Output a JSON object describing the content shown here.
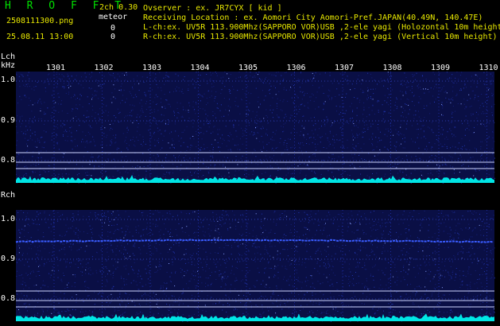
{
  "header": {
    "app_title": "H R O F F T",
    "channel_mode": "2ch 0.30",
    "file_name": "2508111300.png",
    "meteor_label": "meteor",
    "meteor_count_l": "0",
    "timestamp": "25.08.11 13:00",
    "meteor_count_r": "0",
    "observer_line": "Ovserver              : ex. JR7CYX [ kid ]",
    "location_line": "Receiving Location : ex. Aomori City Aomori-Pref.JAPAN(40.49N, 140.47E)",
    "lch_line": "L-ch:ex. UV5R 113.900Mhz(SAPPORO VOR)USB ,2-ele yagi (Holozontal 10m height)",
    "rch_line": "R-ch:ex. UV5R 113.900Mhz(SAPPORO VOR)USB ,2-ele yagi (Vertical 10m height)"
  },
  "time_axis": {
    "ticks": [
      "1301",
      "1302",
      "1303",
      "1304",
      "1305",
      "1306",
      "1307",
      "1308",
      "1309",
      "1310"
    ]
  },
  "lch_panel": {
    "label": "Lch",
    "unit": "kHz",
    "y_ticks": [
      "1.0",
      "0.9",
      "0.8"
    ]
  },
  "rch_panel": {
    "label": "Rch",
    "y_ticks": [
      "1.0",
      "0.9",
      "0.8"
    ]
  },
  "colors": {
    "background": "#000000",
    "title_green": "#00e000",
    "text_yellow": "#e8e800",
    "spectrogram_noise": "#1a2a9a",
    "signal_trace": "#3a5cff",
    "level_cyan": "#00e5e5"
  }
}
